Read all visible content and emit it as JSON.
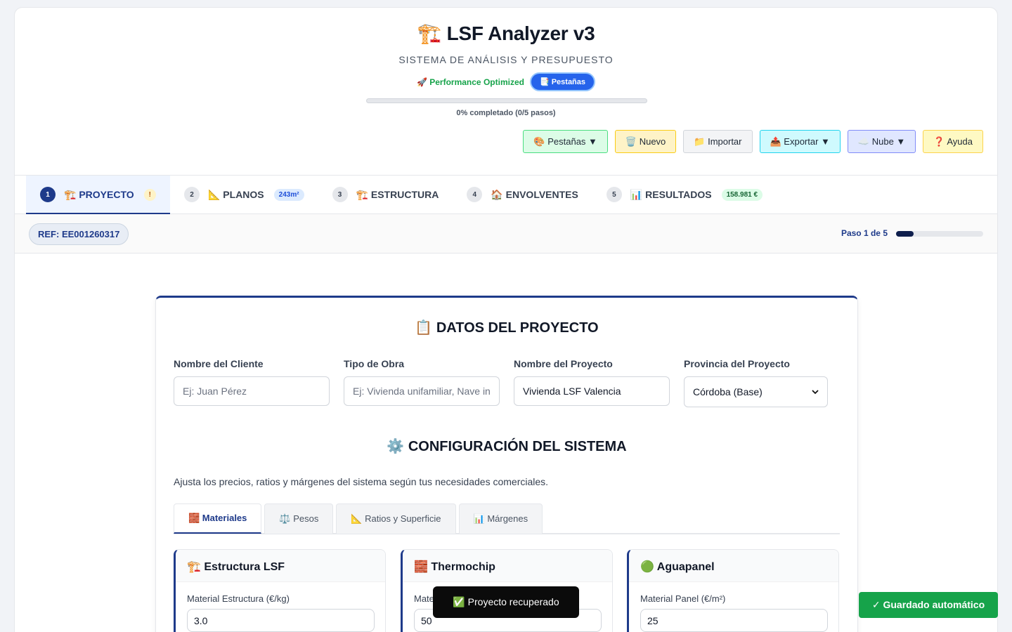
{
  "header": {
    "icon": "🏗️",
    "title": "LSF Analyzer v3",
    "subtitle": "SISTEMA DE ANÁLISIS Y PRESUPUESTO",
    "performance_label": "🚀 Performance Optimized",
    "tabs_pill": "📑 Pestañas",
    "progress_percent": 0,
    "progress_text": "0% completado (0/5 pasos)"
  },
  "toolbar": {
    "pestanas": "🎨 Pestañas ▼",
    "nuevo": "🗑️ Nuevo",
    "importar": "📁 Importar",
    "exportar": "📤 Exportar ▼",
    "nube": "☁️ Nube ▼",
    "ayuda": "❓ Ayuda"
  },
  "steps": [
    {
      "num": "1",
      "label": "🏗️ PROYECTO",
      "badge": "!"
    },
    {
      "num": "2",
      "label": "📐 PLANOS",
      "badge": "243m²"
    },
    {
      "num": "3",
      "label": "🏗️ ESTRUCTURA"
    },
    {
      "num": "4",
      "label": "🏠 ENVOLVENTES"
    },
    {
      "num": "5",
      "label": "📊 RESULTADOS",
      "badge": "158.981 €"
    }
  ],
  "refbar": {
    "ref": "REF: EE001260317",
    "paso": "Paso 1 de 5",
    "step_fraction": 0.2
  },
  "project": {
    "title": "📋 DATOS DEL PROYECTO",
    "cliente_label": "Nombre del Cliente",
    "cliente_placeholder": "Ej: Juan Pérez",
    "obra_label": "Tipo de Obra",
    "obra_placeholder": "Ej: Vivienda unifamiliar, Nave in",
    "proyecto_label": "Nombre del Proyecto",
    "proyecto_value": "Vivienda LSF Valencia",
    "provincia_label": "Provincia del Proyecto",
    "provincia_value": "Córdoba (Base)"
  },
  "config": {
    "title": "⚙️ CONFIGURACIÓN DEL SISTEMA",
    "desc": "Ajusta los precios, ratios y márgenes del sistema según tus necesidades comerciales.",
    "tabs": [
      "🧱 Materiales",
      "⚖️ Pesos",
      "📐 Ratios y Superficie",
      "📊 Márgenes"
    ]
  },
  "materials": [
    {
      "title": "🏗️ Estructura LSF",
      "label": "Material Estructura (€/kg)",
      "value": "3.0"
    },
    {
      "title": "🧱 Thermochip",
      "label": "Mate",
      "value": "50"
    },
    {
      "title": "🟢 Aguapanel",
      "label": "Material Panel (€/m²)",
      "value": "25"
    }
  ],
  "toast": "✅ Proyecto recuperado",
  "autosave": "✓ Guardado automático"
}
